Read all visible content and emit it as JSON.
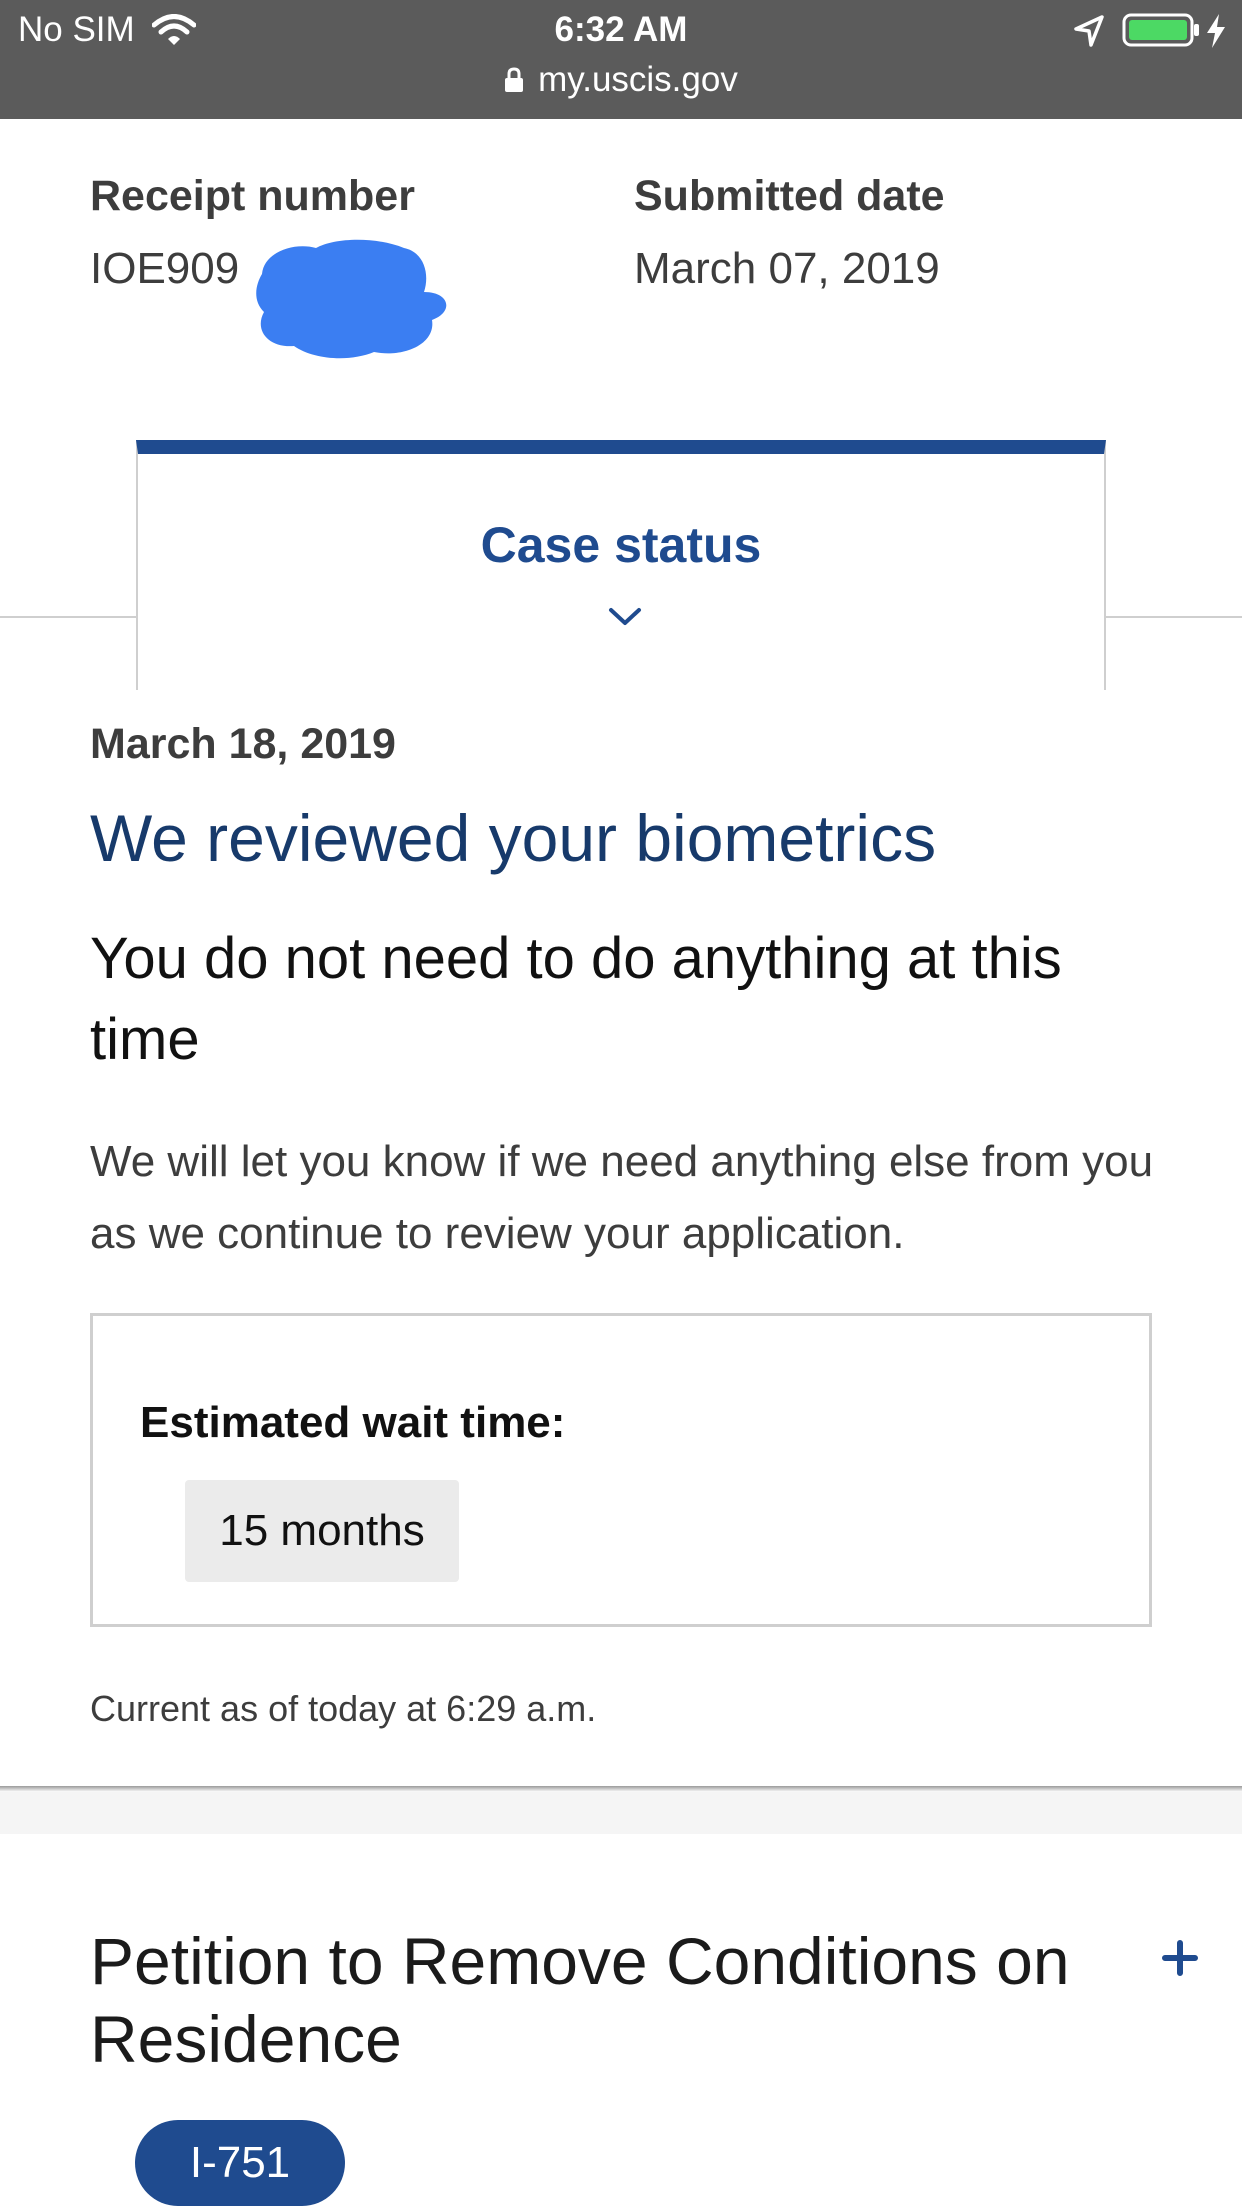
{
  "status_bar": {
    "carrier": "No SIM",
    "time": "6:32 AM",
    "url": "my.uscis.gov",
    "icons": [
      "wifi-icon",
      "location-arrow-icon",
      "battery-icon",
      "charging-bolt-icon",
      "lock-icon"
    ],
    "battery_color": "#4cd964"
  },
  "case": {
    "receipt_label": "Receipt number",
    "receipt_value": "IOE909",
    "submitted_label": "Submitted date",
    "submitted_value": "March 07, 2019"
  },
  "tab": {
    "label": "Case status"
  },
  "status": {
    "date": "March 18, 2019",
    "title": "We reviewed your biometrics",
    "subtitle": "You do not need to do anything at this time",
    "description": "We will let you know if we need anything else from you as we continue to review your application.",
    "wait_label": "Estimated wait time:",
    "wait_value": "15 months",
    "current_as_of": "Current as of today at 6:29 a.m."
  },
  "petition": {
    "title": "Petition to Remove Conditions on Residence",
    "form_badge": "I-751"
  },
  "colors": {
    "brand_blue": "#1f4b8f",
    "title_navy": "#173a6b",
    "redaction_blue": "#3b7ef2",
    "status_bar_gray": "#5b5b5b"
  }
}
